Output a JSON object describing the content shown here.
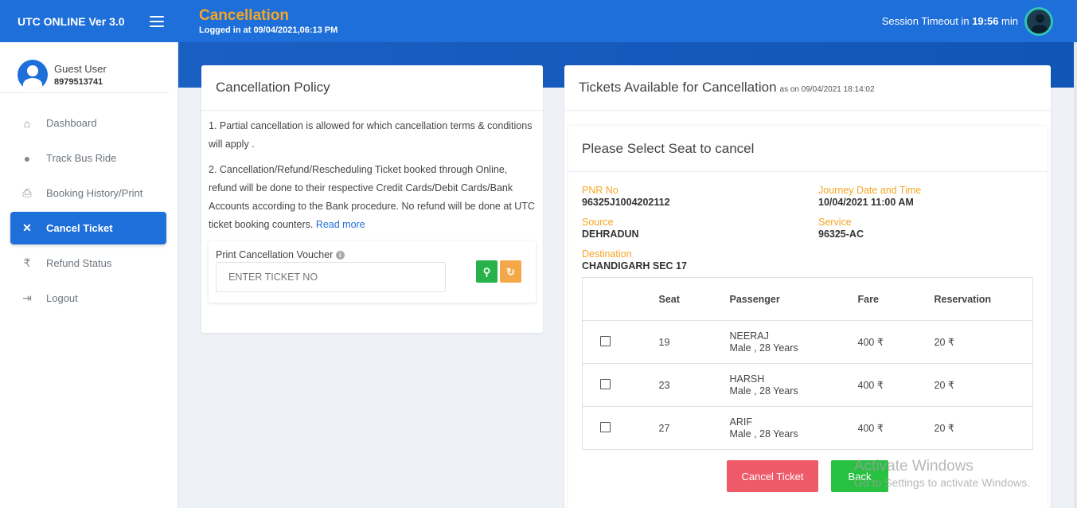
{
  "app": {
    "title": "UTC ONLINE Ver 3.0"
  },
  "header": {
    "page_title": "Cancellation",
    "logged_in": "Logged in at 09/04/2021,06:13 PM",
    "session_prefix": "Session Timeout in ",
    "session_time": "19:56",
    "session_suffix": " min"
  },
  "user": {
    "name": "Guest User",
    "phone": "8979513741"
  },
  "sidebar": {
    "items": [
      {
        "label": "Dashboard",
        "icon": "home-icon",
        "glyph": "⌂",
        "active": false
      },
      {
        "label": "Track Bus Ride",
        "icon": "map-pin-icon",
        "glyph": "●",
        "active": false
      },
      {
        "label": "Booking History/Print",
        "icon": "printer-icon",
        "glyph": "⎙",
        "active": false
      },
      {
        "label": "Cancel Ticket",
        "icon": "close-icon",
        "glyph": "✕",
        "active": true
      },
      {
        "label": "Refund Status",
        "icon": "rupee-icon",
        "glyph": "₹",
        "active": false
      },
      {
        "label": "Logout",
        "icon": "logout-icon",
        "glyph": "⇥",
        "active": false
      }
    ]
  },
  "policy": {
    "title": "Cancellation Policy",
    "point1": "1. Partial cancellation is allowed for which cancellation terms & conditions will apply .",
    "point2": "2. Cancellation/Refund/Rescheduling Ticket booked through Online, refund will be done to their respective Credit Cards/Debit Cards/Bank Accounts according to the Bank procedure. No refund will be done at UTC ticket booking counters.",
    "read_more": "Read more",
    "voucher_label": "Print Cancellation Voucher",
    "ticket_placeholder": "ENTER TICKET NO"
  },
  "tickets": {
    "title": "Tickets Available for Cancellation",
    "as_on": "as on 09/04/2021 18:14:02",
    "select_title": "Please Select Seat to cancel",
    "pnr_label": "PNR No",
    "pnr": "96325J1004202112",
    "journey_label": "Journey Date and Time",
    "journey": "10/04/2021 11:00 AM",
    "source_label": "Source",
    "source": "DEHRADUN",
    "service_label": "Service",
    "service": "96325-AC",
    "destination_label": "Destination",
    "destination": "CHANDIGARH SEC 17",
    "columns": [
      "Seat",
      "Passenger",
      "Fare",
      "Reservation"
    ],
    "rows": [
      {
        "seat": "19",
        "name": "NEERAJ",
        "meta": "Male , 28 Years",
        "fare": "400 ₹",
        "reservation": "20 ₹"
      },
      {
        "seat": "23",
        "name": "HARSH",
        "meta": "Male , 28 Years",
        "fare": "400 ₹",
        "reservation": "20 ₹"
      },
      {
        "seat": "27",
        "name": "ARIF",
        "meta": "Male , 28 Years",
        "fare": "400 ₹",
        "reservation": "20 ₹"
      }
    ],
    "cancel_label": "Cancel Ticket",
    "back_label": "Back"
  },
  "watermark": {
    "line1": "Activate Windows",
    "line2": "Go to Settings to activate Windows."
  }
}
